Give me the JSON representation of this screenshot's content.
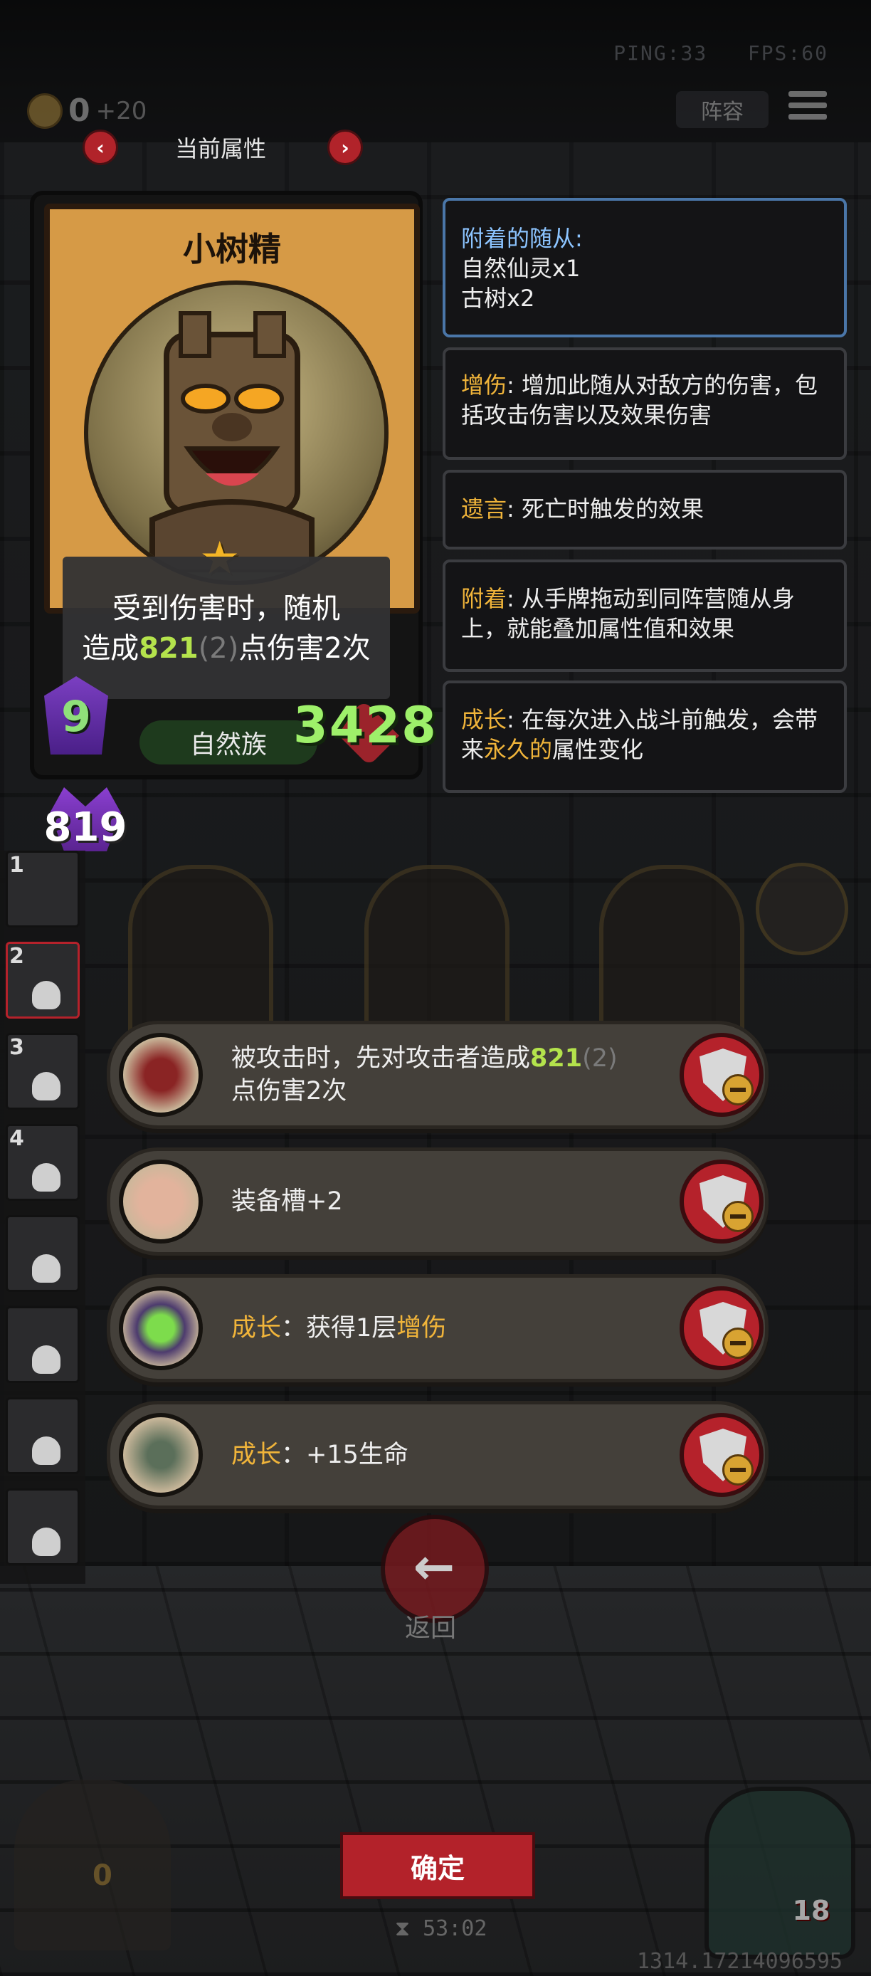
{
  "status": {
    "ping": "PING:33",
    "fps": "FPS:60"
  },
  "gold": {
    "amount": "0",
    "income": "+20"
  },
  "toolbar": {
    "lineup_label": "阵容"
  },
  "attributes_header": {
    "title": "当前属性",
    "prev_icon": "chevron-left-icon",
    "next_icon": "chevron-right-icon"
  },
  "card": {
    "name": "小树精",
    "description_line1": "受到伤害时，随机",
    "description_line2_pre": "造成",
    "description_value": "821",
    "description_paren": "(2)",
    "description_line2_post": "点伤害2次",
    "tribe": "自然族",
    "attack": "9",
    "health": "3428",
    "extra_value": "819"
  },
  "info_panels": [
    {
      "keyword": "附着的随从:",
      "lines": [
        "自然仙灵x1",
        "古树x2"
      ]
    },
    {
      "keyword": "增伤",
      "text": ": 增加此随从对敌方的伤害，包括攻击伤害以及效果伤害"
    },
    {
      "keyword": "遗言",
      "text": ": 死亡时触发的效果"
    },
    {
      "keyword": "附着",
      "text": ": 从手牌拖动到同阵营随从身上，就能叠加属性值和效果"
    },
    {
      "keyword": "成长",
      "text_pre": ": 在每次进入战斗前触发，会带来",
      "highlight": "永久的",
      "text_post": "属性变化"
    }
  ],
  "attached_rows": [
    {
      "pre": "被攻击时，先对攻击者造成",
      "value": "821",
      "paren": "(2)",
      "post": "点伤害2次",
      "icon": "red-hood-icon",
      "icon_color": "#6b1d1d"
    },
    {
      "pre": "装备槽+2",
      "icon": "pig-icon",
      "icon_color": "#c9a08a"
    },
    {
      "keyword": "成长",
      "mid": "：获得1层",
      "highlight": "增伤",
      "icon": "green-crystal-icon",
      "icon_color": "#4d3b6e"
    },
    {
      "keyword": "成长",
      "mid": "：+15生命",
      "icon": "tombstone-icon",
      "icon_color": "#8a9a78"
    }
  ],
  "side_slots": [
    "1",
    "2",
    "3",
    "4",
    "",
    "",
    "",
    ""
  ],
  "back_label": "返回",
  "confirm_label": "确定",
  "timer": "53:02",
  "coords": "1314.17214096595",
  "hero_hp": "18",
  "gate_value": "0",
  "colors": {
    "accent_red": "#b3222a",
    "keyword_gold": "#f0b43a",
    "value_green": "#b4e34c",
    "health_green": "#9ef06a"
  }
}
